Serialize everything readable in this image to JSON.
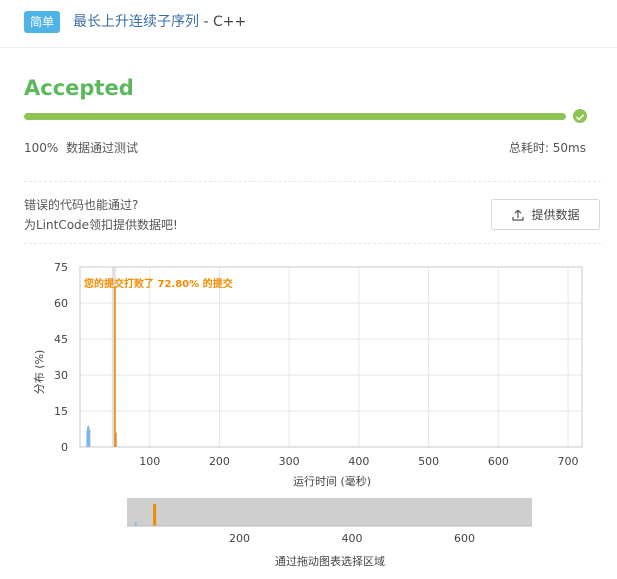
{
  "header": {
    "difficulty": "简单",
    "problem_title": "最长上升连续子序列",
    "language": "C++"
  },
  "result": {
    "status": "Accepted",
    "pass_rate": "100%",
    "pass_label": "数据通过测试",
    "runtime_label": "总耗时:",
    "runtime_value": "50ms",
    "progress": 1.0
  },
  "feedback": {
    "line1": "错误的代码也能通过?",
    "line2": "为LintCode领扣提供数据吧!",
    "button_label": "提供数据"
  },
  "colors": {
    "accent_green": "#5cb85c",
    "progress_green": "#8ec454",
    "badge_blue": "#4fb3e6",
    "highlight_orange": "#f08c00"
  },
  "chart_data": {
    "type": "bar",
    "annotation": "您的提交打败了 72.80% 的提交",
    "xlabel": "运行时间 (毫秒)",
    "ylabel": "分布 (%)",
    "xlim": [
      0,
      720
    ],
    "ylim": [
      0,
      75
    ],
    "xticks": [
      100,
      200,
      300,
      400,
      500,
      600,
      700
    ],
    "yticks": [
      0,
      15,
      30,
      45,
      60,
      75
    ],
    "series": [
      {
        "x": [
          10,
          11,
          12,
          13,
          14
        ],
        "values": [
          7,
          8.5,
          9,
          8,
          7
        ]
      },
      {
        "x": [
          50
        ],
        "values": [
          67
        ]
      },
      {
        "x": [
          52
        ],
        "values": [
          6
        ]
      }
    ],
    "navigator": {
      "label": "通过拖动图表选择区域",
      "ticks": [
        200,
        400,
        600
      ]
    }
  }
}
